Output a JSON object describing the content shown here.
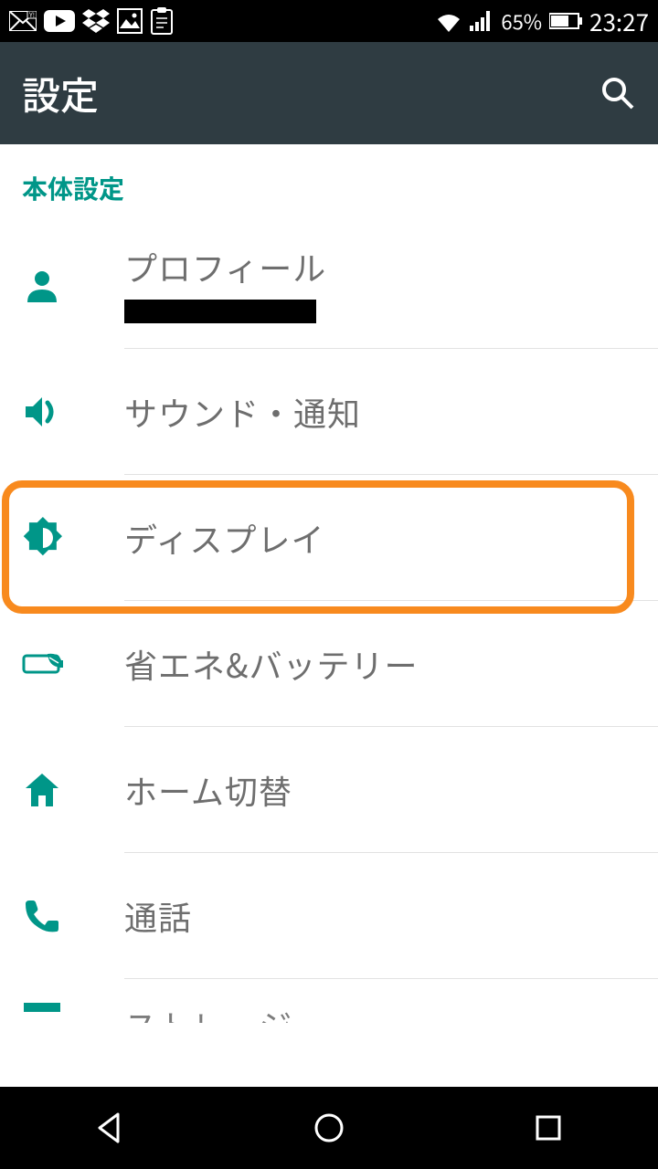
{
  "status_bar": {
    "battery_pct": "65%",
    "time": "23:27"
  },
  "app_bar": {
    "title": "設定"
  },
  "section": {
    "header": "本体設定"
  },
  "items": [
    {
      "label": "プロフィール",
      "sub_redacted": true
    },
    {
      "label": "サウンド・通知"
    },
    {
      "label": "ディスプレイ",
      "highlighted": true
    },
    {
      "label": "省エネ&バッテリー"
    },
    {
      "label": "ホーム切替"
    },
    {
      "label": "通話"
    },
    {
      "label": "ストレージ"
    }
  ],
  "colors": {
    "accent": "#009688",
    "highlight": "#f88a1e",
    "appbar": "#2f3c42"
  }
}
